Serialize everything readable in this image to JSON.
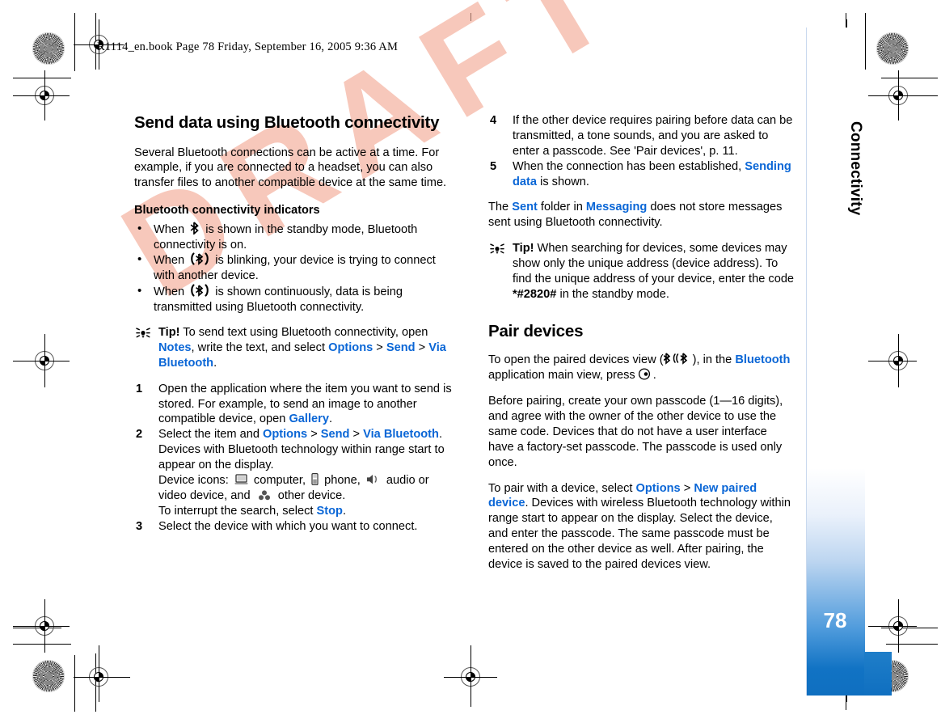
{
  "print_slug": "R1114_en.book  Page 78  Friday, September 16, 2005  9:36 AM",
  "watermark": "DRAFT",
  "sidebar": {
    "chapter_label": "Connectivity",
    "page_number": "78",
    "accent_color": "#0f6fc0"
  },
  "link_color": "#0a66d6",
  "left_column": {
    "heading": "Send data using Bluetooth connectivity",
    "intro": "Several Bluetooth connections can be active at a time. For example, if you are connected to a headset, you can also transfer files to another compatible device at the same time.",
    "subheading": "Bluetooth connectivity indicators",
    "bullets": [
      {
        "before": "When",
        "icon": "bluetooth-icon",
        "after": "is shown in the standby mode, Bluetooth connectivity is on."
      },
      {
        "before": "When",
        "icon": "bluetooth-connecting-icon",
        "after": "is blinking, your device is trying to connect with another device."
      },
      {
        "before": "When",
        "icon": "bluetooth-transmitting-icon",
        "after": "is shown continuously, data is being transmitted using Bluetooth connectivity."
      }
    ],
    "tip": {
      "label": "Tip!",
      "part1": "To send text using Bluetooth connectivity, open",
      "link1": "Notes",
      "part2": ", write the text, and select",
      "link2": "Options",
      "sep1": ">",
      "link3": "Send",
      "sep2": ">",
      "link4": "Via Bluetooth",
      "part3": "."
    },
    "steps": [
      {
        "num": "1",
        "part1": "Open the application where the item you want to send is stored. For example, to send an image to another compatible device, open",
        "link1": "Gallery",
        "part2": "."
      },
      {
        "num": "2",
        "part1": "Select the item and",
        "link1": "Options",
        "sep1": ">",
        "link2": "Send",
        "sep2": ">",
        "link3": "Via Bluetooth",
        "part2": ". Devices with Bluetooth technology within range start to appear on the display.",
        "devices_intro": "Device icons:",
        "device_computer": "computer,",
        "device_phone": "phone,",
        "device_audio": "audio or video device, and",
        "device_other": "other device.",
        "interrupt_part1": "To interrupt the search, select",
        "interrupt_link": "Stop",
        "interrupt_part2": "."
      },
      {
        "num": "3",
        "part1": "Select the device with which you want to connect."
      }
    ]
  },
  "right_column": {
    "steps": [
      {
        "num": "4",
        "part1": "If the other device requires pairing before data can be transmitted, a tone sounds, and you are asked to enter a passcode. See 'Pair devices', p. 11."
      },
      {
        "num": "5",
        "part1": "When the connection has been established,",
        "link1": "Sending data",
        "part2": "is shown."
      }
    ],
    "sent_note": {
      "part1": "The",
      "link1": "Sent",
      "part2": "folder in",
      "link2": "Messaging",
      "part3": "does not store messages sent using Bluetooth connectivity."
    },
    "tip": {
      "label": "Tip!",
      "part1": "When searching for devices, some devices may show only the unique address (device address). To find the unique address of your device, enter the code",
      "code": "*#2820#",
      "part2": "in the standby mode."
    },
    "heading": "Pair devices",
    "open_paired": {
      "part1": "To open the paired devices view (",
      "icon": "paired-devices-icon",
      "part2": "), in the",
      "link1": "Bluetooth",
      "part3": "application main view, press",
      "key_icon": "scroll-key-icon",
      "part4": "."
    },
    "before_pairing": "Before pairing, create your own passcode (1—16 digits), and agree with the owner of the other device to use the same code. Devices that do not have a user interface have a factory-set passcode. The passcode is used only once.",
    "to_pair": {
      "part1": "To pair with a device, select",
      "link1": "Options",
      "sep1": ">",
      "link2": "New paired device",
      "part2": ". Devices with wireless Bluetooth technology within range start to appear on the display. Select the device, and enter the passcode. The same passcode must be entered on the other device as well. After pairing, the device is saved to the paired devices view."
    }
  }
}
